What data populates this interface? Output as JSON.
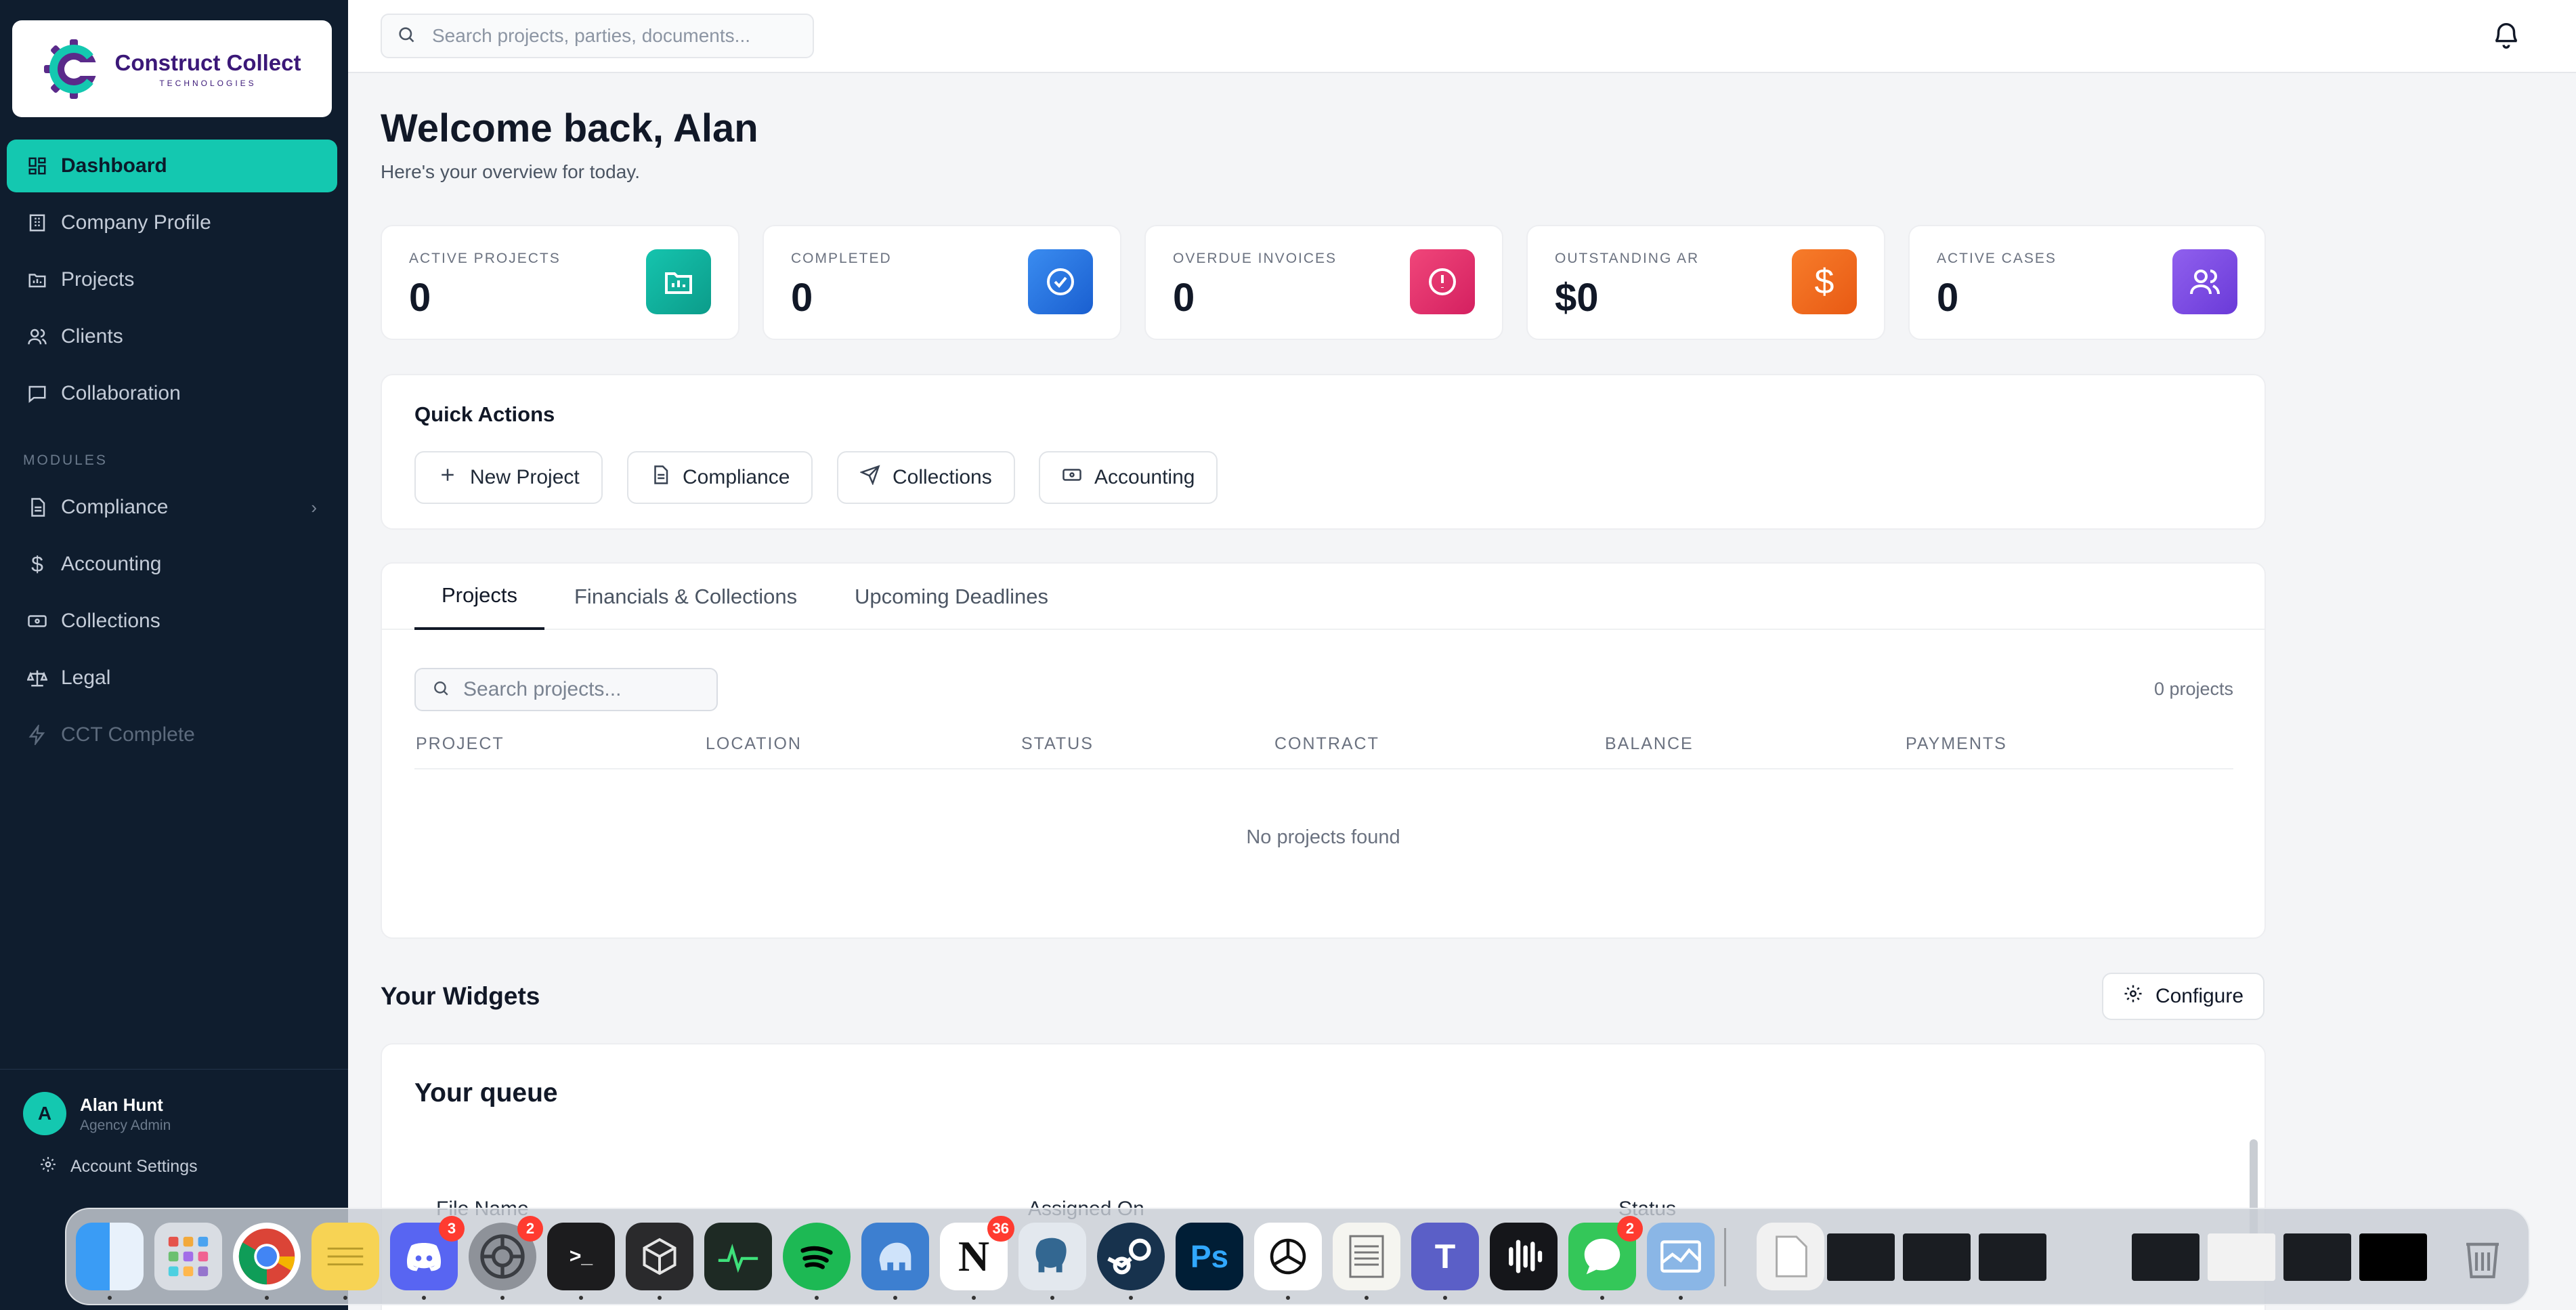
{
  "app": {
    "logo_title": "Construct Collect",
    "logo_subtitle": "TECHNOLOGIES"
  },
  "sidebar": {
    "items": [
      {
        "label": "Dashboard",
        "icon": "dashboard-icon"
      },
      {
        "label": "Company Profile",
        "icon": "building-icon"
      },
      {
        "label": "Projects",
        "icon": "folder-icon"
      },
      {
        "label": "Clients",
        "icon": "users-icon"
      },
      {
        "label": "Collaboration",
        "icon": "chat-icon"
      }
    ],
    "modules_label": "MODULES",
    "modules": [
      {
        "label": "Compliance",
        "icon": "file-icon"
      },
      {
        "label": "Accounting",
        "icon": "dollar-icon"
      },
      {
        "label": "Collections",
        "icon": "banknote-icon"
      },
      {
        "label": "Legal",
        "icon": "scale-icon"
      },
      {
        "label": "CCT Complete",
        "icon": "bolt-icon"
      }
    ],
    "user": {
      "initial": "A",
      "name": "Alan Hunt",
      "role": "Agency Admin"
    },
    "account_settings": "Account Settings"
  },
  "topbar": {
    "search_placeholder": "Search projects, parties, documents..."
  },
  "header": {
    "welcome": "Welcome back, Alan",
    "subtitle": "Here's your overview for today."
  },
  "stats": [
    {
      "label": "ACTIVE PROJECTS",
      "value": "0",
      "color": "#0fb5a0"
    },
    {
      "label": "COMPLETED",
      "value": "0",
      "color": "#2a7ae2"
    },
    {
      "label": "OVERDUE INVOICES",
      "value": "0",
      "color": "#e5336c"
    },
    {
      "label": "OUTSTANDING AR",
      "value": "$0",
      "color": "#f26b1d"
    },
    {
      "label": "ACTIVE CASES",
      "value": "0",
      "color": "#7b4de0"
    }
  ],
  "quick_actions": {
    "title": "Quick Actions",
    "buttons": [
      "New Project",
      "Compliance",
      "Collections",
      "Accounting"
    ]
  },
  "tabs": {
    "items": [
      "Projects",
      "Financials & Collections",
      "Upcoming Deadlines"
    ],
    "search_placeholder": "Search projects...",
    "count": "0 projects",
    "columns": [
      "PROJECT",
      "LOCATION",
      "STATUS",
      "CONTRACT",
      "BALANCE",
      "PAYMENTS"
    ],
    "empty": "No projects found"
  },
  "widgets": {
    "title": "Your Widgets",
    "configure": "Configure",
    "queue_title": "Your queue",
    "queue_columns": [
      "File Name",
      "Assigned On",
      "Status"
    ]
  },
  "dock": {
    "badges": {
      "discord": "3",
      "settings": "2",
      "notion": "36",
      "messages": "2"
    }
  }
}
